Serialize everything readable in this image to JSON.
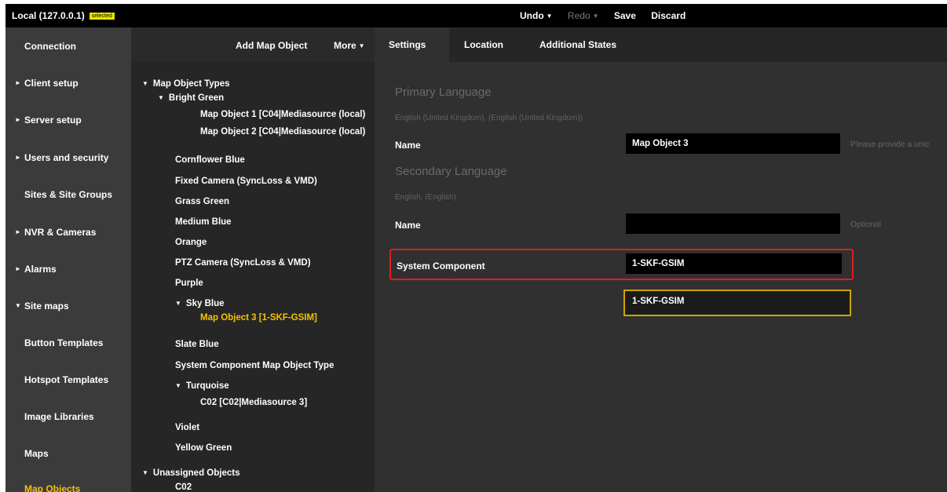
{
  "topbar": {
    "connection": "Local (127.0.0.1)",
    "badge": "selected",
    "undo": "Undo",
    "redo": "Redo",
    "save": "Save",
    "discard": "Discard"
  },
  "nav": {
    "items": [
      {
        "label": "Connection",
        "arrow": false,
        "active": false
      },
      {
        "label": "Client setup",
        "arrow": "right",
        "active": false
      },
      {
        "label": "Server setup",
        "arrow": "right",
        "active": false
      },
      {
        "label": "Users and security",
        "arrow": "right",
        "active": false
      },
      {
        "label": "Sites & Site Groups",
        "arrow": false,
        "active": false
      },
      {
        "label": "NVR & Cameras",
        "arrow": "right",
        "active": false
      },
      {
        "label": "Alarms",
        "arrow": "right",
        "active": false
      },
      {
        "label": "Site maps",
        "arrow": "down",
        "active": false
      },
      {
        "label": "Button Templates",
        "arrow": false,
        "active": false
      },
      {
        "label": "Hotspot Templates",
        "arrow": false,
        "active": false
      },
      {
        "label": "Image Libraries",
        "arrow": false,
        "active": false
      },
      {
        "label": "Maps",
        "arrow": false,
        "active": false
      },
      {
        "label": "Map Objects",
        "arrow": false,
        "active": true
      }
    ],
    "active_color": "#f5c200"
  },
  "tree_panel": {
    "add_button": "Add Map Object",
    "more_button": "More",
    "lines": [
      "Map Object Types",
      "Bright Green",
      "Map Object 1 [C04|Mediasource (local)",
      "Map Object 2 [C04|Mediasource (local)",
      "Cornflower Blue",
      "Fixed Camera (SyncLoss & VMD)",
      "Grass Green",
      "Medium Blue",
      "Orange",
      "PTZ Camera (SyncLoss & VMD)",
      "Purple",
      "Sky Blue",
      "Map Object 3 [1-SKF-GSIM]",
      "Slate Blue",
      "System Component Map Object Type",
      "Turquoise",
      "C02 [C02|Mediasource 3]",
      "Violet",
      "Yellow Green",
      "Unassigned Objects",
      "C02"
    ]
  },
  "main": {
    "tabs": [
      "Settings",
      "Location",
      "Additional States"
    ],
    "primary_language": {
      "title": "Primary Language",
      "subtitle": "English (United Kingdom), (English (United Kingdom))",
      "name_label": "Name",
      "name_value": "Map Object 3",
      "name_hint": "Please provide a unic"
    },
    "secondary_language": {
      "title": "Secondary Language",
      "subtitle": "English, (English)",
      "name_label": "Name",
      "name_value": "",
      "name_hint": "Optional"
    },
    "system_component": {
      "label": "System Component",
      "value": "1-SKF-GSIM",
      "suggestion": "1-SKF-GSIM"
    }
  }
}
